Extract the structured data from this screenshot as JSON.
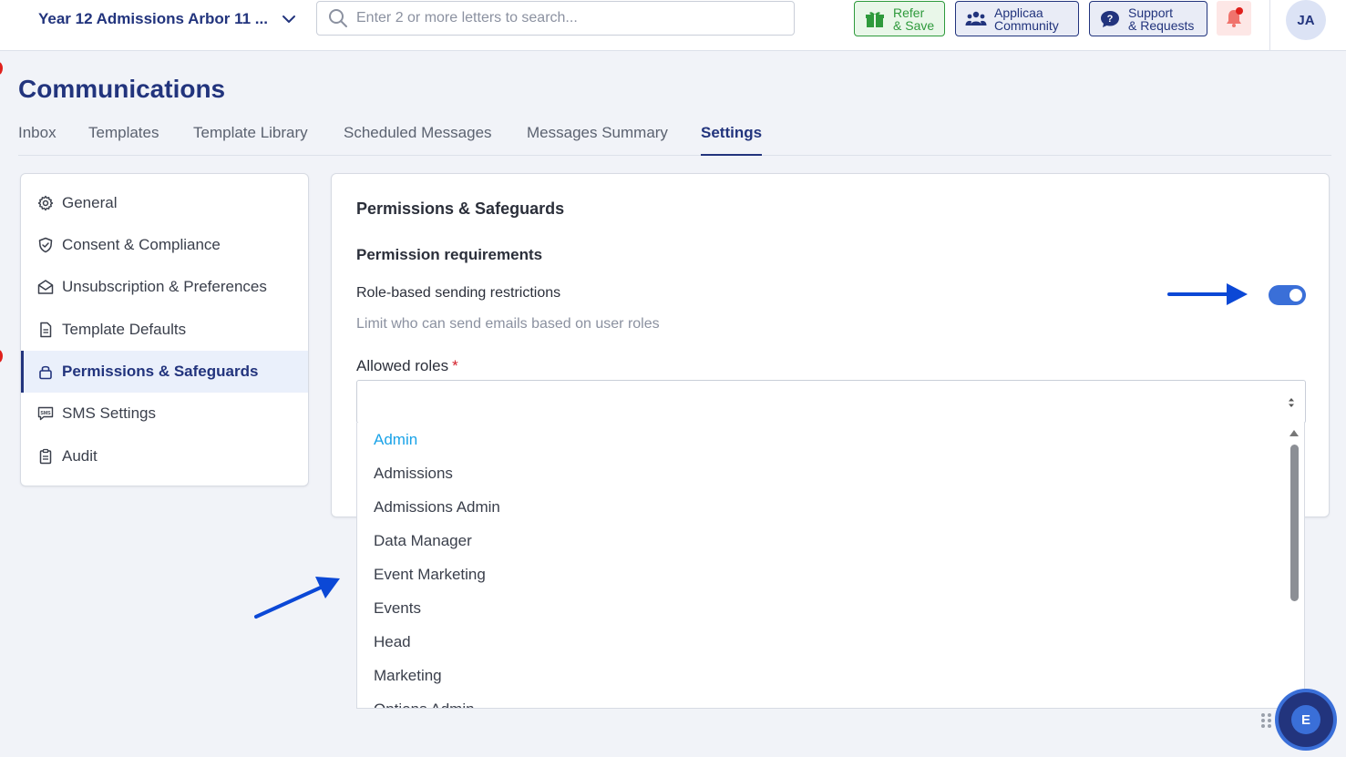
{
  "header": {
    "program_selector": "Year 12 Admissions Arbor 11 ...",
    "search_placeholder": "Enter 2 or more letters to search...",
    "refer": {
      "line1": "Refer",
      "line2": "& Save"
    },
    "community": {
      "line1": "Applicaa",
      "line2": "Community"
    },
    "support": {
      "line1": "Support",
      "line2": "& Requests"
    },
    "avatar_initials": "JA"
  },
  "page": {
    "title": "Communications"
  },
  "tabs": [
    {
      "label": "Inbox"
    },
    {
      "label": "Templates"
    },
    {
      "label": "Template Library"
    },
    {
      "label": "Scheduled Messages"
    },
    {
      "label": "Messages Summary"
    },
    {
      "label": "Settings"
    }
  ],
  "active_tab": "Settings",
  "sidebar": {
    "items": [
      {
        "label": "General",
        "icon": "gear-icon"
      },
      {
        "label": "Consent & Compliance",
        "icon": "shield-check-icon"
      },
      {
        "label": "Unsubscription & Preferences",
        "icon": "envelope-open-icon"
      },
      {
        "label": "Template Defaults",
        "icon": "document-icon"
      },
      {
        "label": "Permissions & Safeguards",
        "icon": "lock-icon"
      },
      {
        "label": "SMS Settings",
        "icon": "sms-icon"
      },
      {
        "label": "Audit",
        "icon": "clipboard-icon"
      }
    ],
    "active": "Permissions & Safeguards"
  },
  "main": {
    "section_title": "Permissions & Safeguards",
    "subsection_title": "Permission requirements",
    "option_label": "Role-based sending restrictions",
    "option_description": "Limit who can send emails based on user roles",
    "toggle_on": true,
    "field_label": "Allowed roles",
    "required_mark": "*",
    "select_value": ""
  },
  "dropdown": {
    "options": [
      {
        "label": "Admin",
        "selected": true
      },
      {
        "label": "Admissions",
        "selected": false
      },
      {
        "label": "Admissions Admin",
        "selected": false
      },
      {
        "label": "Data Manager",
        "selected": false
      },
      {
        "label": "Event Marketing",
        "selected": false
      },
      {
        "label": "Events",
        "selected": false
      },
      {
        "label": "Head",
        "selected": false
      },
      {
        "label": "Marketing",
        "selected": false
      },
      {
        "label": "Options Admin",
        "selected": false
      }
    ]
  },
  "chat_widget": {
    "initial": "E"
  },
  "colors": {
    "brand_navy": "#22347d",
    "accent_blue": "#3a6fd8",
    "selected_option": "#1aa3e8",
    "refer_green": "#2e9a3c",
    "alert_red": "#e0201c",
    "annotation_arrow": "#0b48d6"
  }
}
